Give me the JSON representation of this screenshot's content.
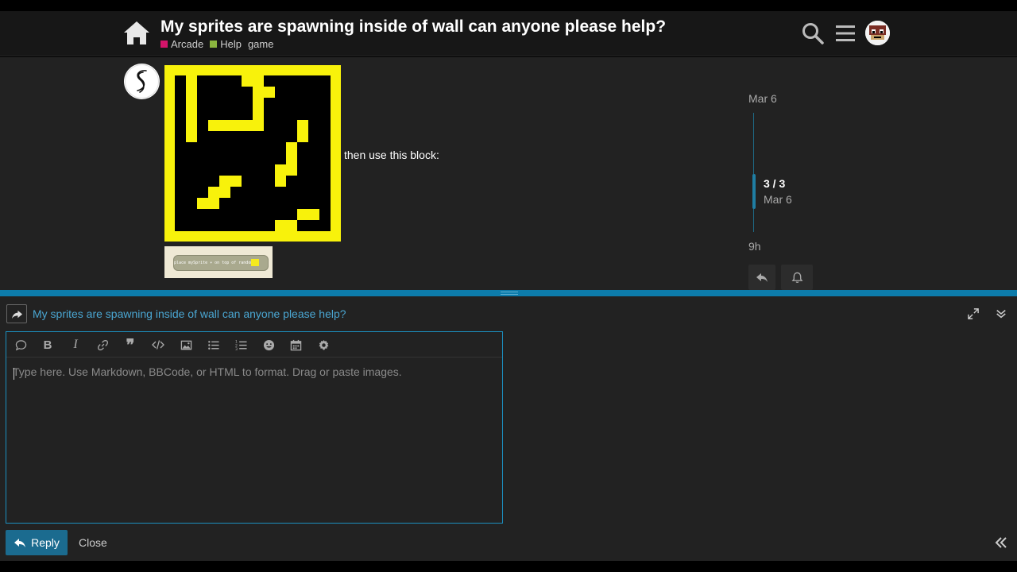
{
  "header": {
    "title": "My sprites are spawning inside of wall can anyone please help?",
    "categories": [
      {
        "label": "Arcade",
        "color": "#d4146a"
      },
      {
        "label": "Help",
        "color": "#8bb53f"
      }
    ],
    "tag": "game",
    "icons": {
      "home": "home-icon",
      "search": "search-icon",
      "menu": "hamburger-menu-icon",
      "user": "user-avatar"
    }
  },
  "post": {
    "text": "then use this block:",
    "block_image_text": "place mySprite ▾ on top of random"
  },
  "timeline": {
    "top_date": "Mar 6",
    "position": "3 / 3",
    "position_date": "Mar 6",
    "bottom_date": "9h"
  },
  "composer": {
    "reply_to_title": "My sprites are spawning inside of wall can anyone please help?",
    "placeholder": "Type here. Use Markdown, BBCode, or HTML to format. Drag or paste images.",
    "reply_label": "Reply",
    "close_label": "Close",
    "accent": "#1c8fbf"
  }
}
